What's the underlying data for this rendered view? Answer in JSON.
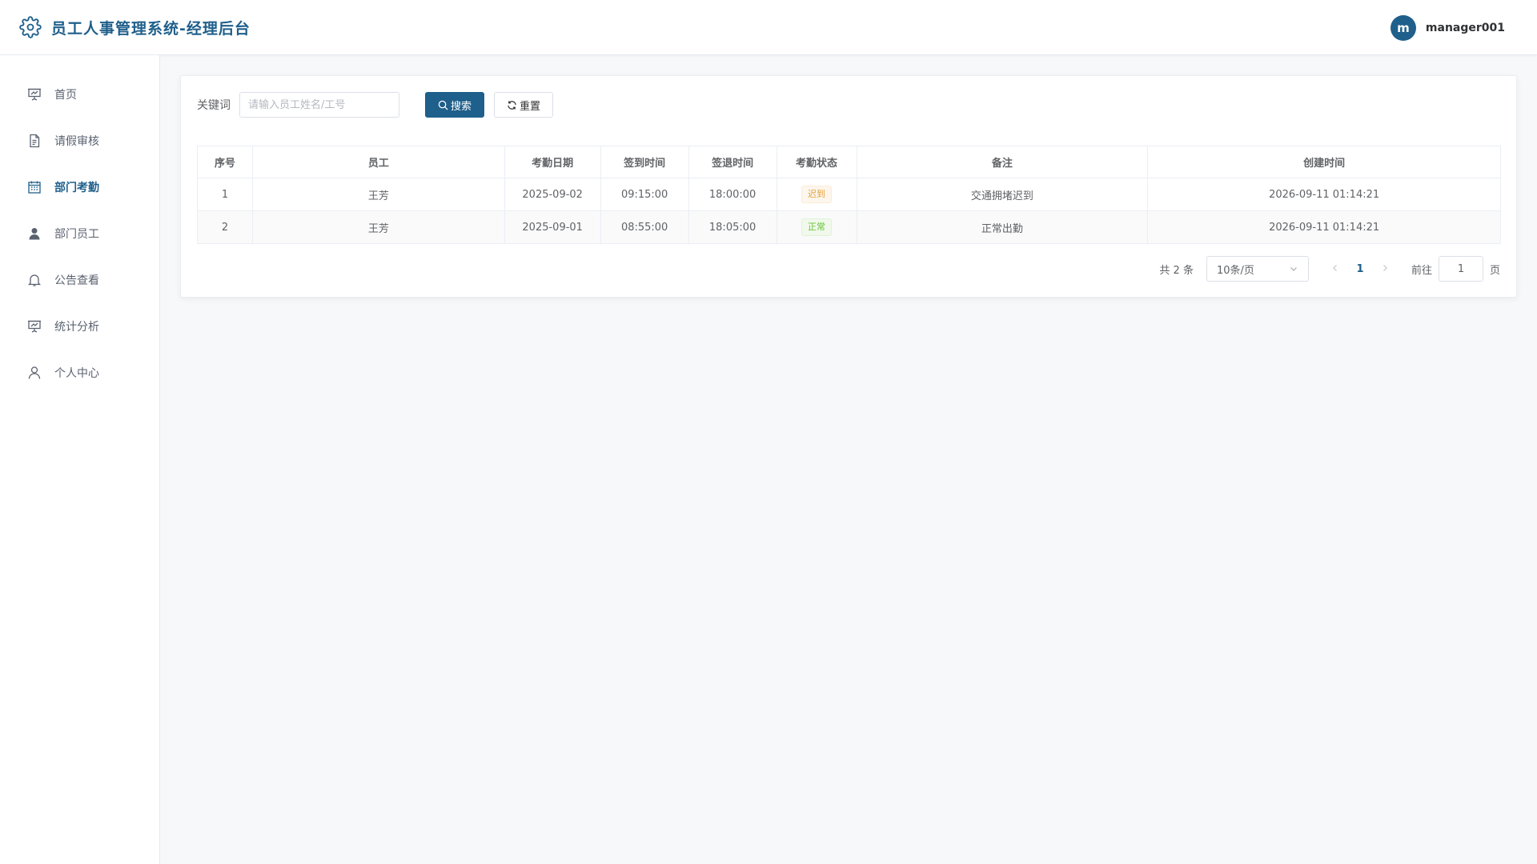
{
  "header": {
    "title": "员工人事管理系统-经理后台",
    "brand_icon": "gear-icon",
    "brand_color": "#1f5f8b",
    "avatar_letter": "m",
    "username": "manager001"
  },
  "sidebar": {
    "items": [
      {
        "label": "首页",
        "icon": "presentation-icon",
        "active": false
      },
      {
        "label": "请假审核",
        "icon": "document-icon",
        "active": false
      },
      {
        "label": "部门考勤",
        "icon": "calendar-icon",
        "active": true
      },
      {
        "label": "部门员工",
        "icon": "user-filled-icon",
        "active": false
      },
      {
        "label": "公告查看",
        "icon": "bell-icon",
        "active": false
      },
      {
        "label": "统计分析",
        "icon": "presentation-chart-icon",
        "active": false
      },
      {
        "label": "个人中心",
        "icon": "user-icon",
        "active": false
      }
    ]
  },
  "search": {
    "label": "关键词",
    "placeholder": "请输入员工姓名/工号",
    "value": "",
    "search_button": "搜索",
    "reset_button": "重置"
  },
  "table": {
    "columns": [
      "序号",
      "员工",
      "考勤日期",
      "签到时间",
      "签退时间",
      "考勤状态",
      "备注",
      "创建时间"
    ],
    "rows": [
      {
        "index": "1",
        "employee": "王芳",
        "date": "2025-09-02",
        "sign_in": "09:15:00",
        "sign_out": "18:00:00",
        "status": "迟到",
        "status_color": "#e6a23c",
        "remark": "交通拥堵迟到",
        "created": "2026-09-11 01:14:21"
      },
      {
        "index": "2",
        "employee": "王芳",
        "date": "2025-09-01",
        "sign_in": "08:55:00",
        "sign_out": "18:05:00",
        "status": "正常",
        "status_color": "#67c23a",
        "remark": "正常出勤",
        "created": "2026-09-11 01:14:21"
      }
    ]
  },
  "pagination": {
    "total": "共 2 条",
    "page_size": "10条/页",
    "current_page": "1",
    "goto_label": "前往",
    "goto_value": "1",
    "page_suffix": "页"
  }
}
